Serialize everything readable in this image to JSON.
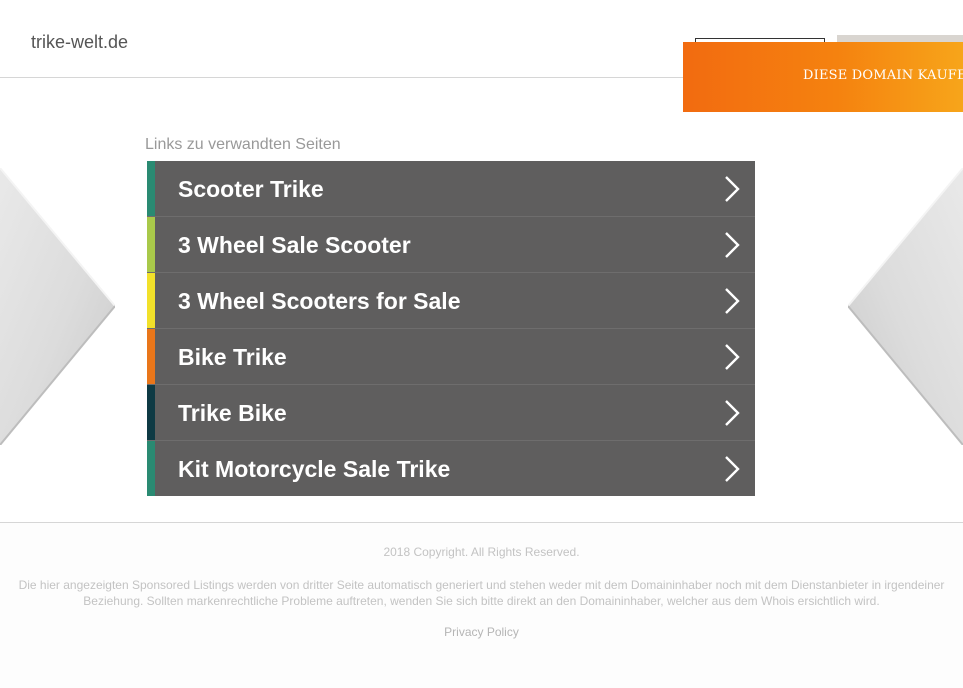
{
  "header": {
    "domain": "trike-welt.de",
    "buy_banner": "DIESE DOMAIN KAUFEN."
  },
  "main": {
    "related_label": "Links zu verwandten Seiten",
    "links": [
      {
        "label": "Scooter Trike",
        "accent": "#2a8a72",
        "icon": "chevron-right-icon"
      },
      {
        "label": "3 Wheel Sale Scooter",
        "accent": "#a9c94a",
        "icon": "chevron-right-icon"
      },
      {
        "label": "3 Wheel Scooters for Sale",
        "accent": "#f2e12a",
        "icon": "chevron-right-icon"
      },
      {
        "label": "Bike Trike",
        "accent": "#e9761a",
        "icon": "chevron-right-icon"
      },
      {
        "label": "Trike Bike",
        "accent": "#0e3a44",
        "icon": "chevron-right-icon"
      },
      {
        "label": "Kit Motorcycle Sale Trike",
        "accent": "#2a8a72",
        "icon": "chevron-right-icon"
      }
    ]
  },
  "footer": {
    "copyright": "2018 Copyright. All Rights Reserved.",
    "disclaimer": "Die hier angezeigten Sponsored Listings werden von dritter Seite automatisch generiert und stehen weder mit dem Domaininhaber noch mit dem Dienstanbieter in irgendeiner Beziehung. Sollten markenrechtliche Probleme auftreten, wenden Sie sich bitte direkt an den Domaininhaber, welcher aus dem Whois ersichtlich wird.",
    "privacy": "Privacy Policy"
  },
  "colors": {
    "link_background": "#5f5e5e",
    "banner_orange": "#f26b10"
  }
}
